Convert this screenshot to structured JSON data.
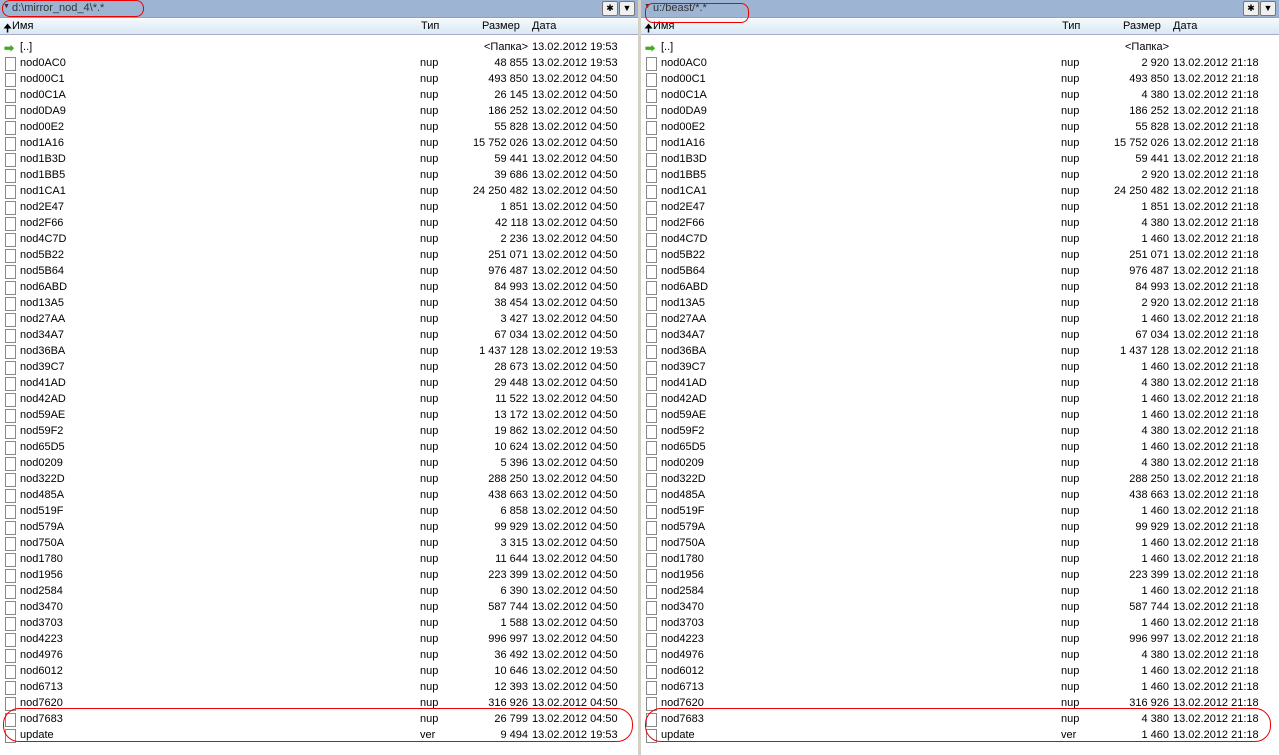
{
  "headers": {
    "name": "Имя",
    "type": "Тип",
    "size": "Размер",
    "date": "Дата"
  },
  "left": {
    "path": "d:\\mirror_nod_4\\*.*",
    "parent": {
      "name": "[..]",
      "size": "<Папка>",
      "date": "13.02.2012 19:53"
    },
    "rows": [
      [
        "nod0AC0",
        "nup",
        "48 855",
        "13.02.2012 19:53"
      ],
      [
        "nod00C1",
        "nup",
        "493 850",
        "13.02.2012 04:50"
      ],
      [
        "nod0C1A",
        "nup",
        "26 145",
        "13.02.2012 04:50"
      ],
      [
        "nod0DA9",
        "nup",
        "186 252",
        "13.02.2012 04:50"
      ],
      [
        "nod00E2",
        "nup",
        "55 828",
        "13.02.2012 04:50"
      ],
      [
        "nod1A16",
        "nup",
        "15 752 026",
        "13.02.2012 04:50"
      ],
      [
        "nod1B3D",
        "nup",
        "59 441",
        "13.02.2012 04:50"
      ],
      [
        "nod1BB5",
        "nup",
        "39 686",
        "13.02.2012 04:50"
      ],
      [
        "nod1CA1",
        "nup",
        "24 250 482",
        "13.02.2012 04:50"
      ],
      [
        "nod2E47",
        "nup",
        "1 851",
        "13.02.2012 04:50"
      ],
      [
        "nod2F66",
        "nup",
        "42 118",
        "13.02.2012 04:50"
      ],
      [
        "nod4C7D",
        "nup",
        "2 236",
        "13.02.2012 04:50"
      ],
      [
        "nod5B22",
        "nup",
        "251 071",
        "13.02.2012 04:50"
      ],
      [
        "nod5B64",
        "nup",
        "976 487",
        "13.02.2012 04:50"
      ],
      [
        "nod6ABD",
        "nup",
        "84 993",
        "13.02.2012 04:50"
      ],
      [
        "nod13A5",
        "nup",
        "38 454",
        "13.02.2012 04:50"
      ],
      [
        "nod27AA",
        "nup",
        "3 427",
        "13.02.2012 04:50"
      ],
      [
        "nod34A7",
        "nup",
        "67 034",
        "13.02.2012 04:50"
      ],
      [
        "nod36BA",
        "nup",
        "1 437 128",
        "13.02.2012 19:53"
      ],
      [
        "nod39C7",
        "nup",
        "28 673",
        "13.02.2012 04:50"
      ],
      [
        "nod41AD",
        "nup",
        "29 448",
        "13.02.2012 04:50"
      ],
      [
        "nod42AD",
        "nup",
        "11 522",
        "13.02.2012 04:50"
      ],
      [
        "nod59AE",
        "nup",
        "13 172",
        "13.02.2012 04:50"
      ],
      [
        "nod59F2",
        "nup",
        "19 862",
        "13.02.2012 04:50"
      ],
      [
        "nod65D5",
        "nup",
        "10 624",
        "13.02.2012 04:50"
      ],
      [
        "nod0209",
        "nup",
        "5 396",
        "13.02.2012 04:50"
      ],
      [
        "nod322D",
        "nup",
        "288 250",
        "13.02.2012 04:50"
      ],
      [
        "nod485A",
        "nup",
        "438 663",
        "13.02.2012 04:50"
      ],
      [
        "nod519F",
        "nup",
        "6 858",
        "13.02.2012 04:50"
      ],
      [
        "nod579A",
        "nup",
        "99 929",
        "13.02.2012 04:50"
      ],
      [
        "nod750A",
        "nup",
        "3 315",
        "13.02.2012 04:50"
      ],
      [
        "nod1780",
        "nup",
        "11 644",
        "13.02.2012 04:50"
      ],
      [
        "nod1956",
        "nup",
        "223 399",
        "13.02.2012 04:50"
      ],
      [
        "nod2584",
        "nup",
        "6 390",
        "13.02.2012 04:50"
      ],
      [
        "nod3470",
        "nup",
        "587 744",
        "13.02.2012 04:50"
      ],
      [
        "nod3703",
        "nup",
        "1 588",
        "13.02.2012 04:50"
      ],
      [
        "nod4223",
        "nup",
        "996 997",
        "13.02.2012 04:50"
      ],
      [
        "nod4976",
        "nup",
        "36 492",
        "13.02.2012 04:50"
      ],
      [
        "nod6012",
        "nup",
        "10 646",
        "13.02.2012 04:50"
      ],
      [
        "nod6713",
        "nup",
        "12 393",
        "13.02.2012 04:50"
      ],
      [
        "nod7620",
        "nup",
        "316 926",
        "13.02.2012 04:50"
      ],
      [
        "nod7683",
        "nup",
        "26 799",
        "13.02.2012 04:50"
      ],
      [
        "update",
        "ver",
        "9 494",
        "13.02.2012 19:53"
      ]
    ]
  },
  "right": {
    "path": "u:/beast/*.*",
    "parent": {
      "name": "[..]",
      "size": "<Папка>",
      "date": ""
    },
    "rows": [
      [
        "nod0AC0",
        "nup",
        "2 920",
        "13.02.2012 21:18"
      ],
      [
        "nod00C1",
        "nup",
        "493 850",
        "13.02.2012 21:18"
      ],
      [
        "nod0C1A",
        "nup",
        "4 380",
        "13.02.2012 21:18"
      ],
      [
        "nod0DA9",
        "nup",
        "186 252",
        "13.02.2012 21:18"
      ],
      [
        "nod00E2",
        "nup",
        "55 828",
        "13.02.2012 21:18"
      ],
      [
        "nod1A16",
        "nup",
        "15 752 026",
        "13.02.2012 21:18"
      ],
      [
        "nod1B3D",
        "nup",
        "59 441",
        "13.02.2012 21:18"
      ],
      [
        "nod1BB5",
        "nup",
        "2 920",
        "13.02.2012 21:18"
      ],
      [
        "nod1CA1",
        "nup",
        "24 250 482",
        "13.02.2012 21:18"
      ],
      [
        "nod2E47",
        "nup",
        "1 851",
        "13.02.2012 21:18"
      ],
      [
        "nod2F66",
        "nup",
        "4 380",
        "13.02.2012 21:18"
      ],
      [
        "nod4C7D",
        "nup",
        "1 460",
        "13.02.2012 21:18"
      ],
      [
        "nod5B22",
        "nup",
        "251 071",
        "13.02.2012 21:18"
      ],
      [
        "nod5B64",
        "nup",
        "976 487",
        "13.02.2012 21:18"
      ],
      [
        "nod6ABD",
        "nup",
        "84 993",
        "13.02.2012 21:18"
      ],
      [
        "nod13A5",
        "nup",
        "2 920",
        "13.02.2012 21:18"
      ],
      [
        "nod27AA",
        "nup",
        "1 460",
        "13.02.2012 21:18"
      ],
      [
        "nod34A7",
        "nup",
        "67 034",
        "13.02.2012 21:18"
      ],
      [
        "nod36BA",
        "nup",
        "1 437 128",
        "13.02.2012 21:18"
      ],
      [
        "nod39C7",
        "nup",
        "1 460",
        "13.02.2012 21:18"
      ],
      [
        "nod41AD",
        "nup",
        "4 380",
        "13.02.2012 21:18"
      ],
      [
        "nod42AD",
        "nup",
        "1 460",
        "13.02.2012 21:18"
      ],
      [
        "nod59AE",
        "nup",
        "1 460",
        "13.02.2012 21:18"
      ],
      [
        "nod59F2",
        "nup",
        "4 380",
        "13.02.2012 21:18"
      ],
      [
        "nod65D5",
        "nup",
        "1 460",
        "13.02.2012 21:18"
      ],
      [
        "nod0209",
        "nup",
        "4 380",
        "13.02.2012 21:18"
      ],
      [
        "nod322D",
        "nup",
        "288 250",
        "13.02.2012 21:18"
      ],
      [
        "nod485A",
        "nup",
        "438 663",
        "13.02.2012 21:18"
      ],
      [
        "nod519F",
        "nup",
        "1 460",
        "13.02.2012 21:18"
      ],
      [
        "nod579A",
        "nup",
        "99 929",
        "13.02.2012 21:18"
      ],
      [
        "nod750A",
        "nup",
        "1 460",
        "13.02.2012 21:18"
      ],
      [
        "nod1780",
        "nup",
        "1 460",
        "13.02.2012 21:18"
      ],
      [
        "nod1956",
        "nup",
        "223 399",
        "13.02.2012 21:18"
      ],
      [
        "nod2584",
        "nup",
        "1 460",
        "13.02.2012 21:18"
      ],
      [
        "nod3470",
        "nup",
        "587 744",
        "13.02.2012 21:18"
      ],
      [
        "nod3703",
        "nup",
        "1 460",
        "13.02.2012 21:18"
      ],
      [
        "nod4223",
        "nup",
        "996 997",
        "13.02.2012 21:18"
      ],
      [
        "nod4976",
        "nup",
        "4 380",
        "13.02.2012 21:18"
      ],
      [
        "nod6012",
        "nup",
        "1 460",
        "13.02.2012 21:18"
      ],
      [
        "nod6713",
        "nup",
        "1 460",
        "13.02.2012 21:18"
      ],
      [
        "nod7620",
        "nup",
        "316 926",
        "13.02.2012 21:18"
      ],
      [
        "nod7683",
        "nup",
        "4 380",
        "13.02.2012 21:18"
      ],
      [
        "update",
        "ver",
        "1 460",
        "13.02.2012 21:18"
      ]
    ]
  }
}
